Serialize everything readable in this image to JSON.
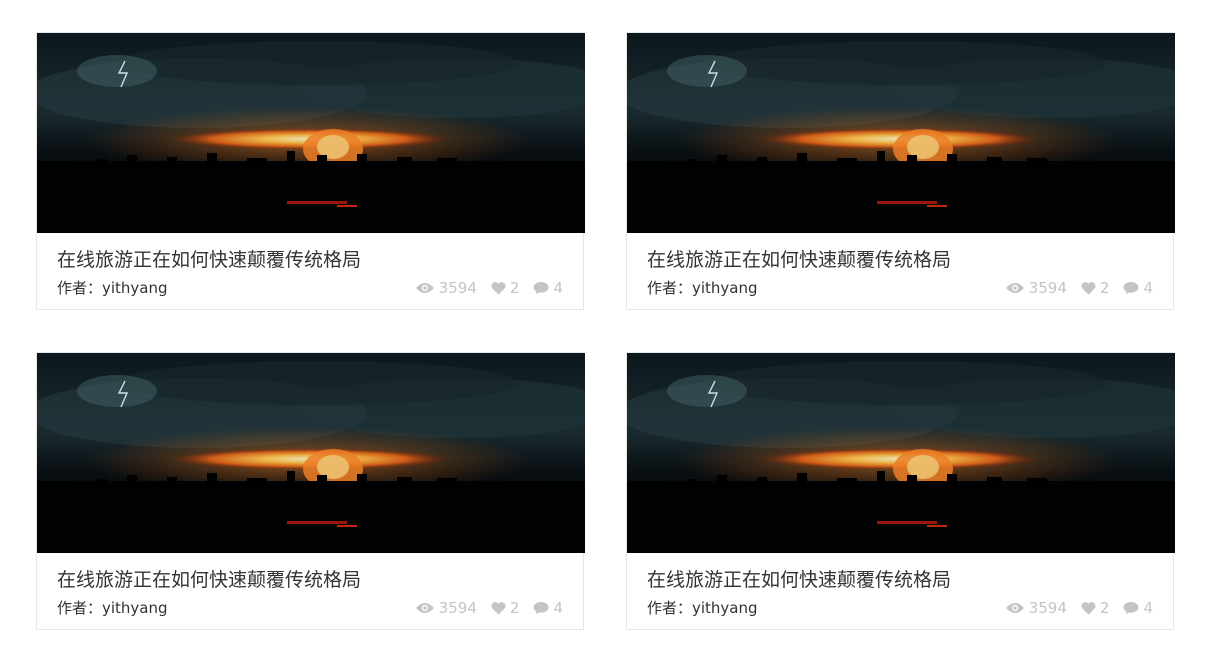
{
  "cards": [
    {
      "title": "在线旅游正在如何快速颠覆传统格局",
      "author": "作者：yithyang",
      "views": "3594",
      "likes": "2",
      "comments": "4"
    },
    {
      "title": "在线旅游正在如何快速颠覆传统格局",
      "author": "作者：yithyang",
      "views": "3594",
      "likes": "2",
      "comments": "4"
    },
    {
      "title": "在线旅游正在如何快速颠覆传统格局",
      "author": "作者：yithyang",
      "views": "3594",
      "likes": "2",
      "comments": "4"
    },
    {
      "title": "在线旅游正在如何快速颠覆传统格局",
      "author": "作者：yithyang",
      "views": "3594",
      "likes": "2",
      "comments": "4"
    }
  ],
  "icons": {
    "views": "eye-icon",
    "likes": "heart-icon",
    "comments": "comment-icon"
  },
  "colors": {
    "meta": "#c4c4c4",
    "text": "#333333",
    "border": "#e6e6e6"
  }
}
